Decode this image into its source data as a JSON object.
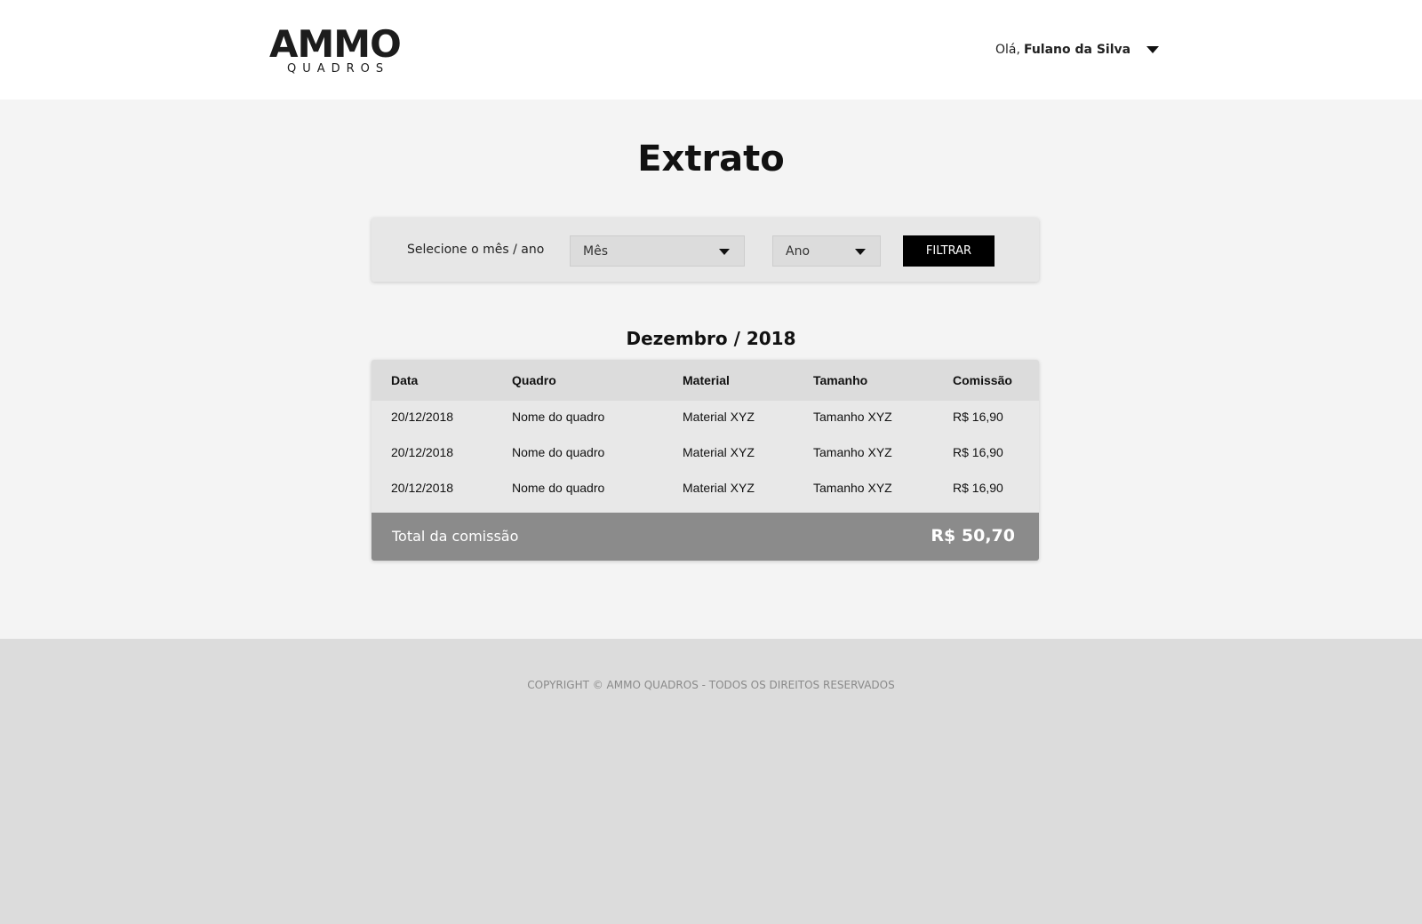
{
  "brand": {
    "logo_main": "AMMO",
    "logo_sub": "QUADROS"
  },
  "user_menu": {
    "greeting": "Olá,",
    "name": "Fulano da Silva",
    "icon": "chevron-down-icon"
  },
  "page": {
    "title": "Extrato"
  },
  "filter": {
    "label": "Selecione o mês / ano",
    "month_value": "Mês",
    "year_value": "Ano",
    "button_label": "FILTRAR"
  },
  "statement": {
    "period": "Dezembro / 2018",
    "columns": [
      "Data",
      "Quadro",
      "Material",
      "Tamanho",
      "Comissão"
    ],
    "rows": [
      [
        "20/12/2018",
        "Nome do quadro",
        "Material XYZ",
        "Tamanho XYZ",
        "R$ 16,90"
      ],
      [
        "20/12/2018",
        "Nome do quadro",
        "Material XYZ",
        "Tamanho XYZ",
        "R$ 16,90"
      ],
      [
        "20/12/2018",
        "Nome do quadro",
        "Material XYZ",
        "Tamanho XYZ",
        "R$ 16,90"
      ]
    ],
    "total_label": "Total da comissão",
    "total_value": "R$ 50,70"
  },
  "footer": {
    "copyright": "COPYRIGHT © AMMO QUADROS - TODOS OS DIREITOS RESERVADOS"
  },
  "colors": {
    "button_bg": "#000000",
    "total_bar": "#8b8b8b",
    "page_bg": "#f4f4f4",
    "footer_bg": "#dcdcdc"
  }
}
